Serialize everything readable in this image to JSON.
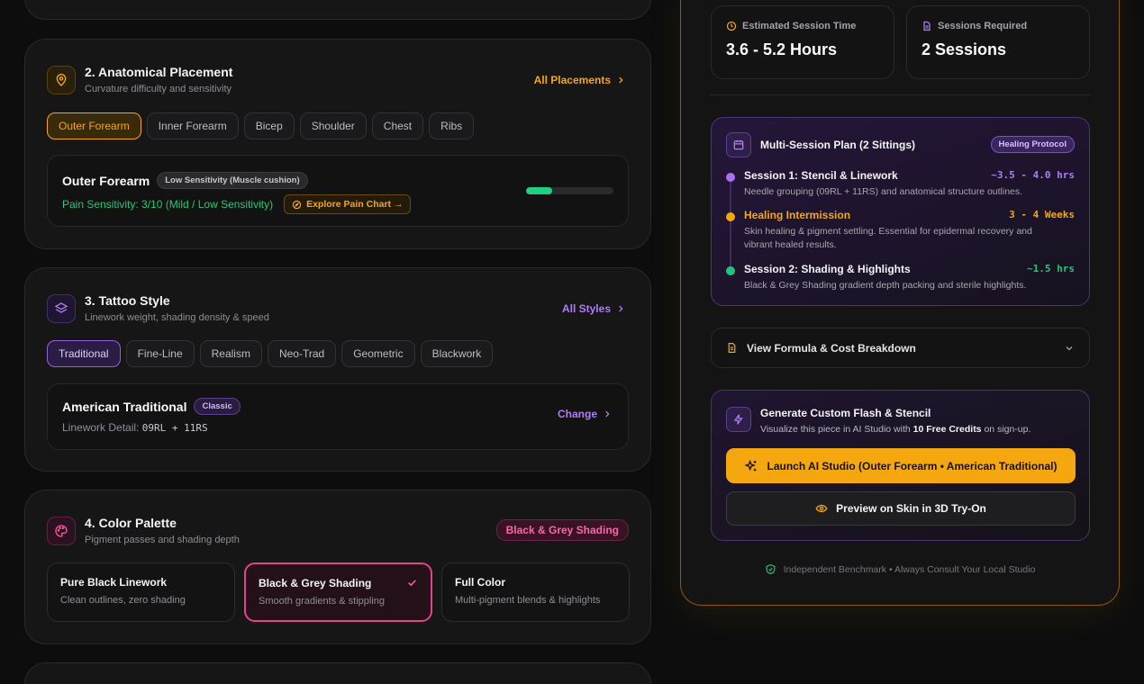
{
  "placement": {
    "title": "2. Anatomical Placement",
    "subtitle": "Curvature difficulty and sensitivity",
    "all_link": "All Placements",
    "chips": [
      "Outer Forearm",
      "Inner Forearm",
      "Bicep",
      "Shoulder",
      "Chest",
      "Ribs"
    ],
    "selected_chip_index": 0,
    "detail": {
      "name": "Outer Forearm",
      "badge": "Low Sensitivity (Muscle cushion)",
      "pain_text": "Pain Sensitivity: 3/10 (Mild / Low Sensitivity)",
      "explore_button": "Explore Pain Chart →",
      "pain_level": 0.3
    }
  },
  "style": {
    "title": "3. Tattoo Style",
    "subtitle": "Linework weight, shading density & speed",
    "all_link": "All Styles",
    "chips": [
      "Traditional",
      "Fine-Line",
      "Realism",
      "Neo-Trad",
      "Geometric",
      "Blackwork"
    ],
    "selected_chip_index": 0,
    "detail": {
      "name": "American Traditional",
      "badge": "Classic",
      "linework_label": "Linework Detail:",
      "linework_value": "09RL + 11RS",
      "change_link": "Change"
    }
  },
  "palette": {
    "title": "4. Color Palette",
    "subtitle": "Pigment passes and shading depth",
    "badge": "Black & Grey Shading",
    "options": [
      {
        "title": "Pure Black Linework",
        "sub": "Clean outlines, zero shading"
      },
      {
        "title": "Black & Grey Shading",
        "sub": "Smooth gradients & stippling"
      },
      {
        "title": "Full Color",
        "sub": "Multi-pigment blends & highlights"
      }
    ],
    "selected_index": 1
  },
  "summary": {
    "time_label": "Estimated Session Time",
    "time_value": "3.6 - 5.2 Hours",
    "sessions_label": "Sessions Required",
    "sessions_value": "2 Sessions"
  },
  "plan": {
    "title": "Multi-Session Plan (2 Sittings)",
    "badge": "Healing Protocol",
    "items": [
      {
        "title": "Session 1: Stencil & Linework",
        "time": "~3.5 - 4.0 hrs",
        "desc": "Needle grouping (09RL + 11RS) and anatomical structure outlines.",
        "color": "#a970f0"
      },
      {
        "title": "Healing Intermission",
        "time": "3 - 4 Weeks",
        "desc": "Skin healing & pigment settling. Essential for epidermal recovery and vibrant healed results.",
        "color": "#f5a70f"
      },
      {
        "title": "Session 2: Shading & Highlights",
        "time": "~1.5 hrs",
        "desc": "Black & Grey Shading gradient depth packing and sterile highlights.",
        "color": "#21c47a"
      }
    ]
  },
  "formula": {
    "label": "View Formula & Cost Breakdown"
  },
  "flash": {
    "title": "Generate Custom Flash & Stencil",
    "desc_pre": "Visualize this piece in AI Studio with ",
    "desc_bold": "10 Free Credits",
    "desc_post": " on sign-up.",
    "launch_button": "Launch AI Studio (Outer Forearm • American Traditional)",
    "preview_button": "Preview on Skin in 3D Try-On"
  },
  "footer": {
    "text": "Independent Benchmark • Always Consult Your Local Studio"
  },
  "colors": {
    "accent_orange": "#f5a70f",
    "accent_purple": "#a970f0",
    "accent_pink": "#e0458a",
    "accent_green": "#21c47a"
  }
}
